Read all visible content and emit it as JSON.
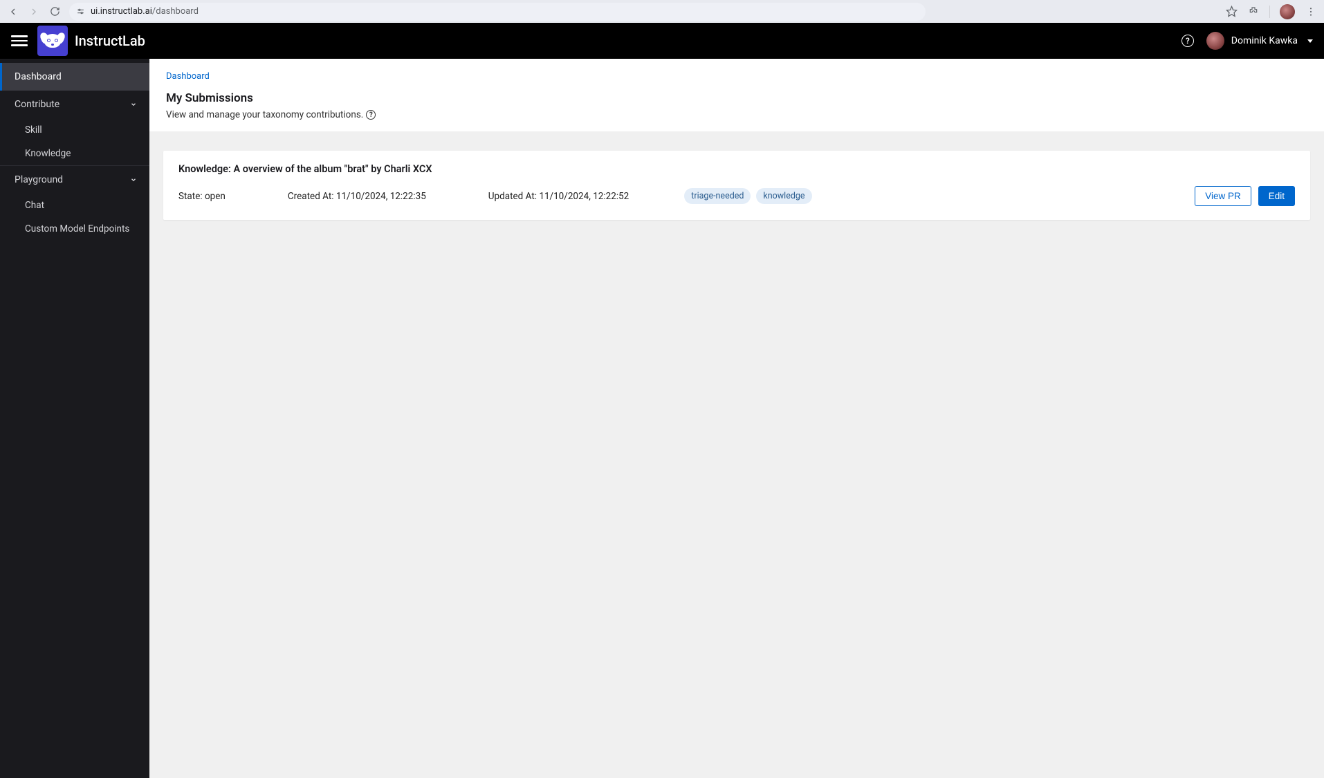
{
  "browser": {
    "url_domain": "ui.instructlab.ai",
    "url_path": "/dashboard"
  },
  "app": {
    "title": "InstructLab",
    "user_name": "Dominik Kawka"
  },
  "sidebar": {
    "items": [
      {
        "label": "Dashboard"
      },
      {
        "label": "Contribute"
      },
      {
        "label": "Playground"
      }
    ],
    "contribute_children": [
      {
        "label": "Skill"
      },
      {
        "label": "Knowledge"
      }
    ],
    "playground_children": [
      {
        "label": "Chat"
      },
      {
        "label": "Custom Model Endpoints"
      }
    ]
  },
  "page": {
    "breadcrumb": "Dashboard",
    "title": "My Submissions",
    "description": "View and manage your taxonomy contributions."
  },
  "submission": {
    "title": "Knowledge: A overview of the album \"brat\" by Charli XCX",
    "state_label": "State: open",
    "created_label": "Created At: 11/10/2024, 12:22:35",
    "updated_label": "Updated At: 11/10/2024, 12:22:52",
    "tags": [
      "triage-needed",
      "knowledge"
    ],
    "view_pr_label": "View PR",
    "edit_label": "Edit"
  }
}
